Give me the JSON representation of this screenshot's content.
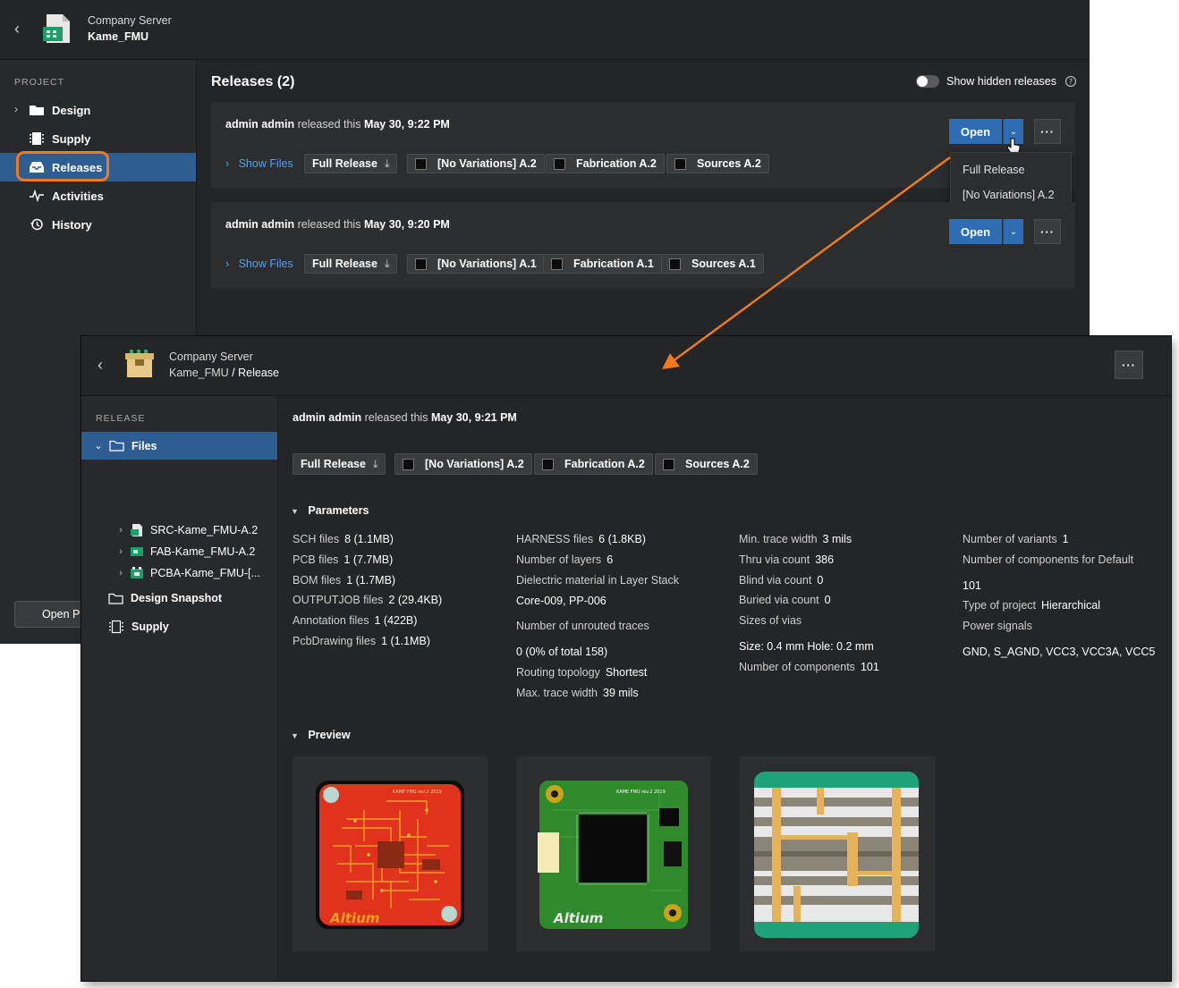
{
  "back_window": {
    "header": {
      "server": "Company Server",
      "project": "Kame_FMU"
    },
    "sidebar": {
      "section": "PROJECT",
      "items": [
        {
          "label": "Design",
          "icon": "folder-icon"
        },
        {
          "label": "Supply",
          "icon": "chip-icon"
        },
        {
          "label": "Releases",
          "icon": "inbox-icon",
          "selected": true
        },
        {
          "label": "Activities",
          "icon": "pulse-icon"
        },
        {
          "label": "History",
          "icon": "history-icon"
        }
      ],
      "open_button": "Open Pr"
    },
    "main": {
      "title": "Releases (2)",
      "show_hidden": "Show hidden releases",
      "releases": [
        {
          "by": "admin admin",
          "mid": "released this",
          "date": "May 30, 9:22 PM",
          "show_files": "Show Files",
          "chips": [
            "Full Release",
            "[No Variations] A.2",
            "Fabrication A.2",
            "Sources A.2"
          ]
        },
        {
          "by": "admin admin",
          "mid": "released this",
          "date": "May 30, 9:20 PM",
          "show_files": "Show Files",
          "chips": [
            "Full Release",
            "[No Variations] A.1",
            "Fabrication A.1",
            "Sources A.1"
          ]
        }
      ],
      "open_label": "Open",
      "more_label": "···",
      "dropdown": [
        "Full Release",
        "[No Variations] A.2"
      ]
    }
  },
  "front_window": {
    "header": {
      "server": "Company Server",
      "project": "Kame_FMU",
      "sep": " / ",
      "page": "Release"
    },
    "more_label": "···",
    "sidebar": {
      "section": "RELEASE",
      "files": "Files",
      "children": [
        "SRC-Kame_FMU-A.2",
        "FAB-Kame_FMU-A.2",
        "PCBA-Kame_FMU-[..."
      ],
      "design_snapshot": "Design Snapshot",
      "supply": "Supply"
    },
    "main": {
      "by": "admin admin",
      "mid": "released this",
      "date": "May 30, 9:21 PM",
      "chips": [
        "Full Release",
        "[No Variations] A.2",
        "Fabrication A.2",
        "Sources A.2"
      ],
      "parameters_title": "Parameters",
      "col1": [
        {
          "k": "SCH files",
          "v": "8 (1.1MB)"
        },
        {
          "k": "PCB files",
          "v": "1 (7.7MB)"
        },
        {
          "k": "BOM files",
          "v": "1 (1.7MB)"
        },
        {
          "k": "OUTPUTJOB files",
          "v": "2 (29.4KB)"
        },
        {
          "k": "Annotation files",
          "v": "1 (422B)"
        },
        {
          "k": "PcbDrawing files",
          "v": "1 (1.1MB)"
        }
      ],
      "col2": {
        "harness_k": "HARNESS files",
        "harness_v": "6 (1.8KB)",
        "layers_k": "Number of layers",
        "layers_v": "6",
        "dielectric_k": "Dielectric material in Layer Stack",
        "dielectric_v": "Core-009, PP-006",
        "unrouted_k": "Number of unrouted traces",
        "unrouted_v": "0 (0% of total 158)",
        "topology_k": "Routing topology",
        "topology_v": "Shortest",
        "maxw_k": "Max. trace width",
        "maxw_v": "39 mils"
      },
      "col3": {
        "minw_k": "Min. trace width",
        "minw_v": "3 mils",
        "thru_k": "Thru via count",
        "thru_v": "386",
        "blind_k": "Blind via count",
        "blind_v": "0",
        "buried_k": "Buried via count",
        "buried_v": "0",
        "sizes_k": "Sizes of vias",
        "sizes_v": "Size: 0.4 mm Hole: 0.2 mm",
        "ncomp_k": "Number of components",
        "ncomp_v": "101"
      },
      "col4": {
        "variants_k": "Number of variants",
        "variants_v": "1",
        "compdef_k": "Number of components for Default",
        "compdef_v": "101",
        "ptype_k": "Type of project",
        "ptype_v": "Hierarchical",
        "power_k": "Power signals",
        "power_v": "GND, S_AGND, VCC3, VCC3A, VCC5"
      },
      "preview_title": "Preview",
      "board_text": "KAME FMU rev.2 2019",
      "logo_text": "Altium",
      "colors": {
        "accent": "#2e6db4",
        "selection": "#2e5d94",
        "highlight": "#ef7a1f",
        "link": "#5aa0e6"
      }
    }
  }
}
